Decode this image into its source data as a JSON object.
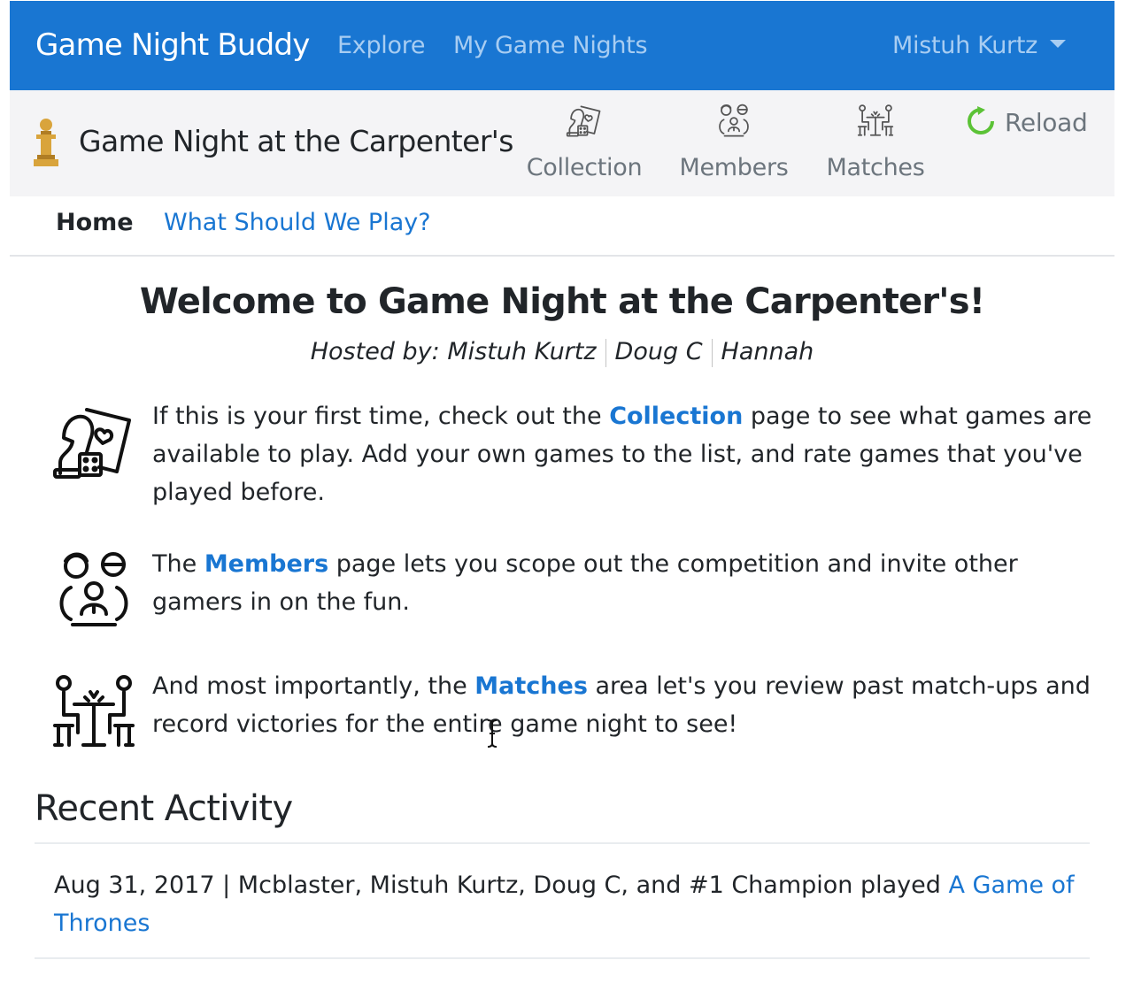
{
  "navbar": {
    "brand": "Game Night Buddy",
    "links": [
      {
        "label": "Explore"
      },
      {
        "label": "My Game Nights"
      }
    ],
    "user": "Mistuh Kurtz",
    "colors": {
      "background": "#1976d2",
      "link": "#a8cdf2"
    }
  },
  "group": {
    "icon": "pawn-icon",
    "title": "Game Night at the Carpenter's",
    "nav": [
      {
        "label": "Collection",
        "icon": "cards-dice-icon"
      },
      {
        "label": "Members",
        "icon": "people-icon"
      },
      {
        "label": "Matches",
        "icon": "players-table-icon"
      }
    ],
    "reload": {
      "label": "Reload",
      "icon": "refresh-icon",
      "color": "#5bc236"
    }
  },
  "tabs": [
    {
      "label": "Home",
      "active": true
    },
    {
      "label": "What Should We Play?",
      "active": false
    }
  ],
  "welcome": {
    "title": "Welcome to Game Night at the Carpenter's!",
    "hosted_prefix": "Hosted by: ",
    "hosts": [
      "Mistuh Kurtz",
      "Doug C",
      "Hannah"
    ]
  },
  "features": [
    {
      "icon": "cards-dice-icon",
      "before": "If this is your first time, check out the ",
      "link": "Collection",
      "after": " page to see what games are available to play. Add your own games to the list, and rate games that you've played before."
    },
    {
      "icon": "people-icon",
      "before": "The ",
      "link": "Members",
      "after": " page lets you scope out the competition and invite other gamers in on the fun."
    },
    {
      "icon": "players-table-icon",
      "before": "And most importantly, the ",
      "link": "Matches",
      "after": " area let's you review past match-ups and record victories for the entire game night to see!"
    }
  ],
  "recent": {
    "title": "Recent Activity",
    "items": [
      {
        "text": "Aug 31, 2017 | Mcblaster, Mistuh Kurtz, Doug C, and #1 Champion played ",
        "link": "A Game of Thrones"
      }
    ]
  }
}
